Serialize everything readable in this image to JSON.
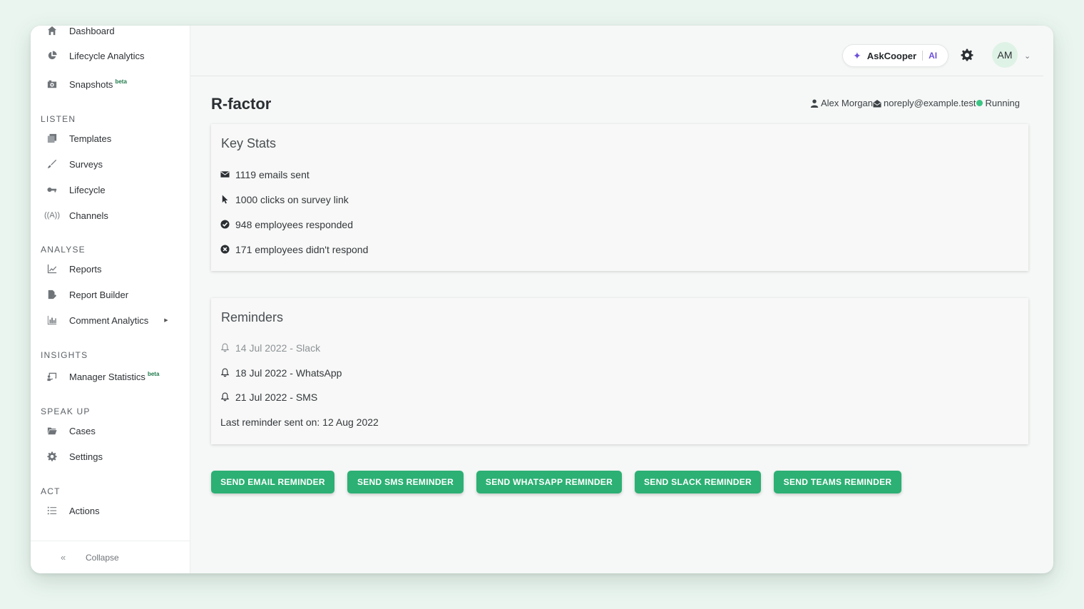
{
  "sidebar": {
    "items_top": [
      {
        "label": "Dashboard",
        "icon": "home-icon"
      },
      {
        "label": "Lifecycle Analytics",
        "icon": "pie-chart-icon"
      },
      {
        "label": "Snapshots",
        "icon": "camera-icon",
        "badge": "beta"
      }
    ],
    "sections": {
      "listen": "LISTEN",
      "analyse": "ANALYSE",
      "insights": "INSIGHTS",
      "speak_up": "SPEAK UP",
      "act": "ACT"
    },
    "listen_items": [
      {
        "label": "Templates",
        "icon": "copy-icon"
      },
      {
        "label": "Surveys",
        "icon": "brush-icon"
      },
      {
        "label": "Lifecycle",
        "icon": "key-icon"
      },
      {
        "label": "Channels",
        "icon": "broadcast-icon"
      }
    ],
    "analyse_items": [
      {
        "label": "Reports",
        "icon": "line-chart-icon"
      },
      {
        "label": "Report Builder",
        "icon": "file-edit-icon"
      },
      {
        "label": "Comment Analytics",
        "icon": "bar-chart-icon"
      }
    ],
    "insights_items": [
      {
        "label": "Manager Statistics",
        "icon": "presentation-icon",
        "badge": "beta"
      }
    ],
    "speak_up_items": [
      {
        "label": "Cases",
        "icon": "folder-icon"
      },
      {
        "label": "Settings",
        "icon": "cog-icon"
      }
    ],
    "act_items": [
      {
        "label": "Actions",
        "icon": "list-icon"
      }
    ],
    "collapse_label": "Collapse"
  },
  "header": {
    "askcooper_label": "AskCooper",
    "ai_label": "AI",
    "avatar_initials": "AM"
  },
  "page": {
    "title": "R-factor",
    "owner": "Alex Morgan",
    "email": "noreply@example.test",
    "status": "Running",
    "status_color": "#3cc584"
  },
  "key_stats": {
    "title": "Key Stats",
    "emails_sent": "1119 emails sent",
    "clicks": "1000 clicks on survey link",
    "responded": "948 employees responded",
    "not_responded": "171 employees didn't respond"
  },
  "reminders": {
    "title": "Reminders",
    "items": [
      {
        "label": "14 Jul 2022 - Slack",
        "past": true
      },
      {
        "label": "18 Jul 2022 - WhatsApp",
        "past": false
      },
      {
        "label": "21 Jul 2022 - SMS",
        "past": false
      }
    ],
    "last_sent": "Last reminder sent on: 12 Aug 2022"
  },
  "actions": {
    "email": "SEND EMAIL REMINDER",
    "sms": "SEND SMS REMINDER",
    "whatsapp": "SEND WHATSAPP REMINDER",
    "slack": "SEND SLACK REMINDER",
    "teams": "SEND TEAMS REMINDER",
    "accent": "#2cb074"
  }
}
